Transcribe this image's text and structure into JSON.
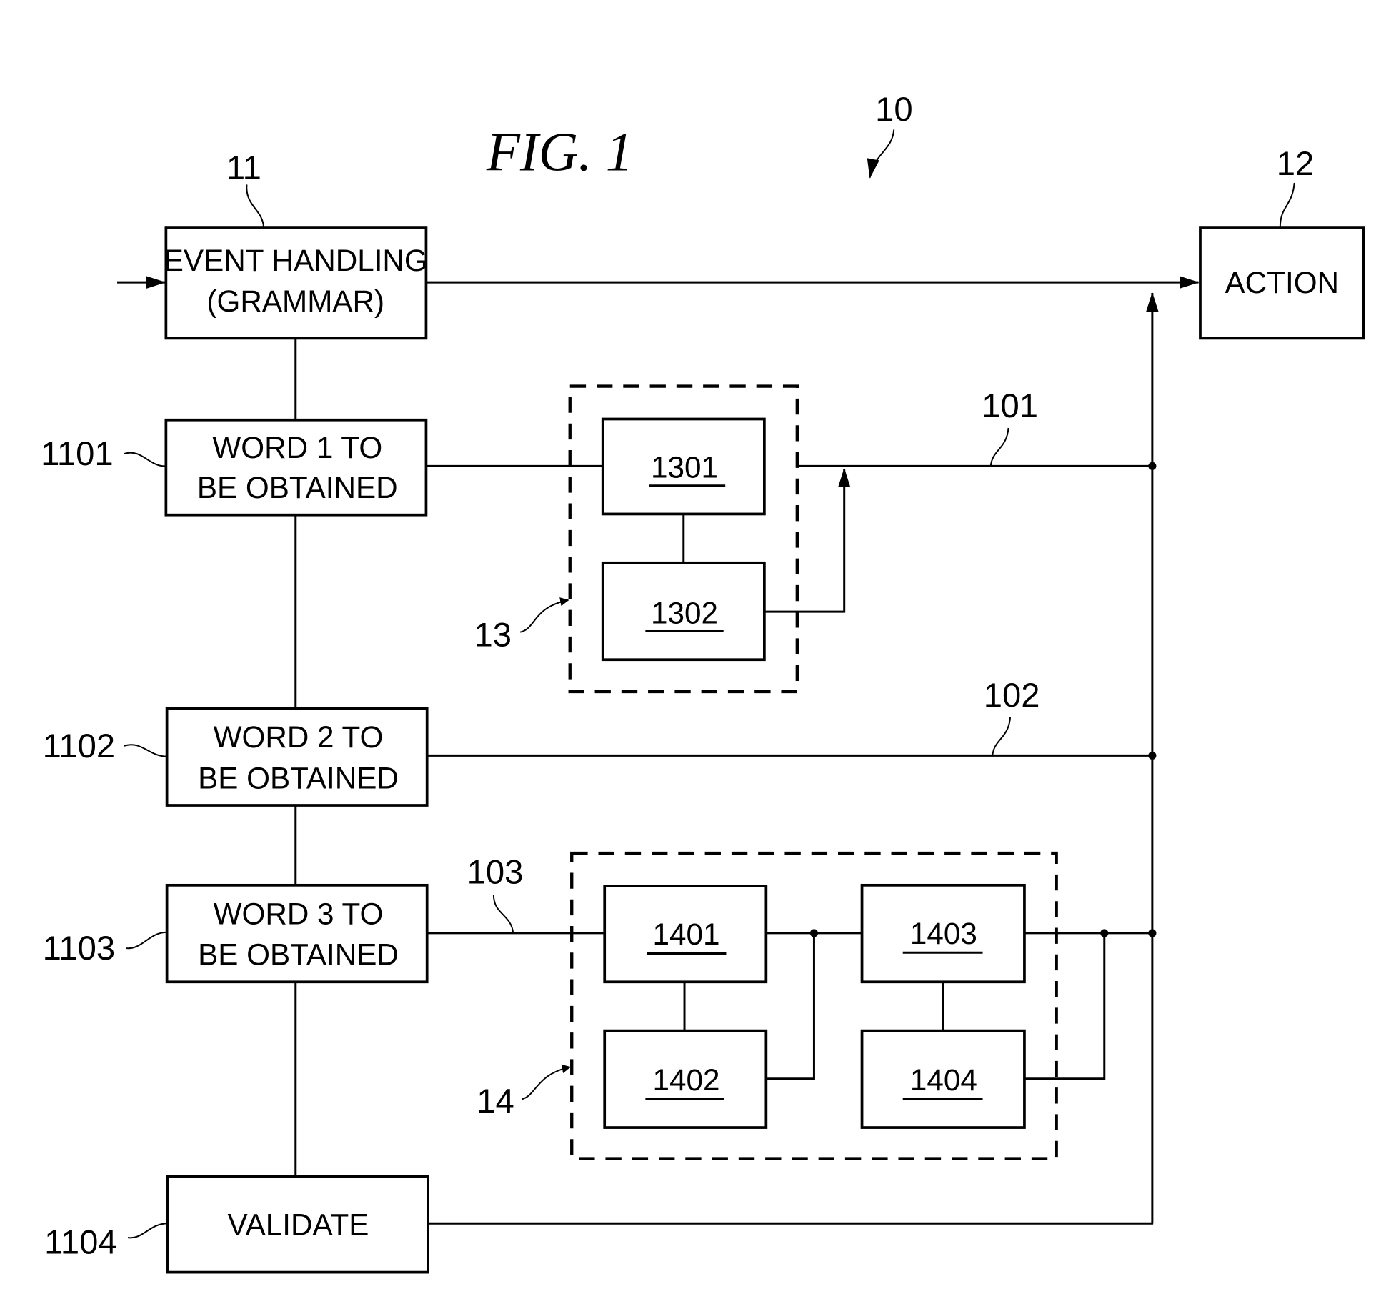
{
  "figure": {
    "title": "FIG. 1",
    "system_ref": "10"
  },
  "blocks": {
    "event_handling": {
      "ref": "11",
      "line1": "EVENT HANDLING",
      "line2": "(GRAMMAR)"
    },
    "action": {
      "ref": "12",
      "label": "ACTION"
    },
    "word1": {
      "ref": "1101",
      "line1": "WORD 1 TO",
      "line2": "BE OBTAINED"
    },
    "word2": {
      "ref": "1102",
      "line1": "WORD 2 TO",
      "line2": "BE OBTAINED"
    },
    "word3": {
      "ref": "1103",
      "line1": "WORD 3 TO",
      "line2": "BE OBTAINED"
    },
    "validate": {
      "ref": "1104",
      "label": "VALIDATE"
    },
    "group13": {
      "ref": "13",
      "b1": "1301",
      "b2": "1302"
    },
    "group14": {
      "ref": "14",
      "b1": "1401",
      "b2": "1402",
      "b3": "1403",
      "b4": "1404"
    }
  },
  "lines": {
    "l101": "101",
    "l102": "102",
    "l103": "103"
  }
}
